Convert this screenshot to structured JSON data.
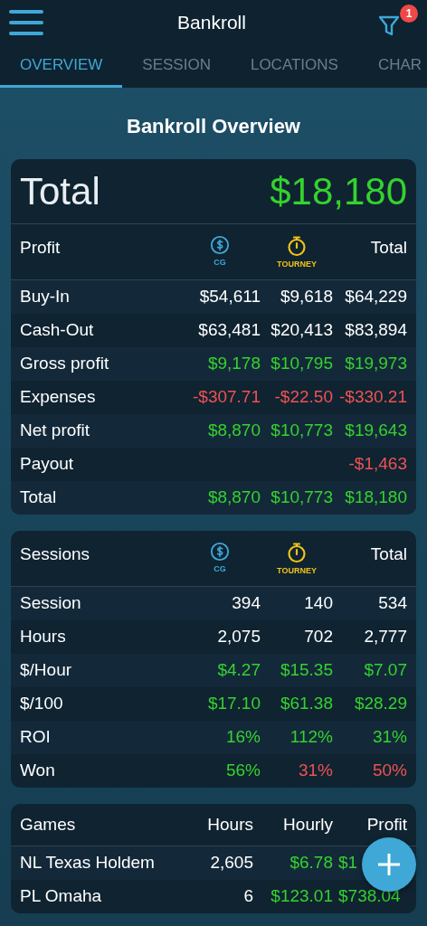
{
  "app_bar": {
    "title": "Bankroll",
    "filter_badge": "1"
  },
  "tabs": [
    {
      "label": "OVERVIEW",
      "selected": true
    },
    {
      "label": "SESSION",
      "selected": false
    },
    {
      "label": "LOCATIONS",
      "selected": false
    },
    {
      "label": "CHAR",
      "selected": false
    }
  ],
  "page_title": "Bankroll Overview",
  "total": {
    "label": "Total",
    "value": "$18,180",
    "color": "#35d22e"
  },
  "profit": {
    "columns": [
      {
        "kind": "text",
        "text": "Profit"
      },
      {
        "kind": "cash",
        "text": "CG"
      },
      {
        "kind": "tourney",
        "text": "TOURNEY"
      },
      {
        "kind": "text",
        "text": "Total"
      }
    ],
    "rows": [
      [
        {
          "text": "Buy-In",
          "color": "#ffffff"
        },
        {
          "text": "$54,611",
          "color": "#ffffff"
        },
        {
          "text": "$9,618",
          "color": "#ffffff"
        },
        {
          "text": "$64,229",
          "color": "#ffffff"
        }
      ],
      [
        {
          "text": "Cash-Out",
          "color": "#ffffff"
        },
        {
          "text": "$63,481",
          "color": "#ffffff"
        },
        {
          "text": "$20,413",
          "color": "#ffffff"
        },
        {
          "text": "$83,894",
          "color": "#ffffff"
        }
      ],
      [
        {
          "text": "Gross profit",
          "color": "#ffffff"
        },
        {
          "text": "$9,178",
          "color": "#35d22e"
        },
        {
          "text": "$10,795",
          "color": "#35d22e"
        },
        {
          "text": "$19,973",
          "color": "#35d22e"
        }
      ],
      [
        {
          "text": "Expenses",
          "color": "#ffffff"
        },
        {
          "text": "-$307.71",
          "color": "#f05252"
        },
        {
          "text": "-$22.50",
          "color": "#f05252"
        },
        {
          "text": "-$330.21",
          "color": "#f05252"
        }
      ],
      [
        {
          "text": "Net profit",
          "color": "#ffffff"
        },
        {
          "text": "$8,870",
          "color": "#35d22e"
        },
        {
          "text": "$10,773",
          "color": "#35d22e"
        },
        {
          "text": "$19,643",
          "color": "#35d22e"
        }
      ],
      [
        {
          "text": "Payout",
          "color": "#ffffff"
        },
        null,
        null,
        {
          "text": "-$1,463",
          "color": "#f05252"
        }
      ],
      [
        {
          "text": "Total",
          "color": "#ffffff"
        },
        {
          "text": "$8,870",
          "color": "#35d22e"
        },
        {
          "text": "$10,773",
          "color": "#35d22e"
        },
        {
          "text": "$18,180",
          "color": "#35d22e"
        }
      ]
    ]
  },
  "sessions": {
    "columns": [
      {
        "kind": "text",
        "text": "Sessions"
      },
      {
        "kind": "cash",
        "text": "CG"
      },
      {
        "kind": "tourney",
        "text": "TOURNEY"
      },
      {
        "kind": "text",
        "text": "Total"
      }
    ],
    "rows": [
      [
        {
          "text": "Session",
          "color": "#ffffff"
        },
        {
          "text": "394",
          "color": "#ffffff"
        },
        {
          "text": "140",
          "color": "#ffffff"
        },
        {
          "text": "534",
          "color": "#ffffff"
        }
      ],
      [
        {
          "text": "Hours",
          "color": "#ffffff"
        },
        {
          "text": "2,075",
          "color": "#ffffff"
        },
        {
          "text": "702",
          "color": "#ffffff"
        },
        {
          "text": "2,777",
          "color": "#ffffff"
        }
      ],
      [
        {
          "text": "$/Hour",
          "color": "#ffffff"
        },
        {
          "text": "$4.27",
          "color": "#35d22e"
        },
        {
          "text": "$15.35",
          "color": "#35d22e"
        },
        {
          "text": "$7.07",
          "color": "#35d22e"
        }
      ],
      [
        {
          "text": "$/100",
          "color": "#ffffff"
        },
        {
          "text": "$17.10",
          "color": "#35d22e"
        },
        {
          "text": "$61.38",
          "color": "#35d22e"
        },
        {
          "text": "$28.29",
          "color": "#35d22e"
        }
      ],
      [
        {
          "text": "ROI",
          "color": "#ffffff"
        },
        {
          "text": "16%",
          "color": "#35d22e"
        },
        {
          "text": "112%",
          "color": "#35d22e"
        },
        {
          "text": "31%",
          "color": "#35d22e"
        }
      ],
      [
        {
          "text": "Won",
          "color": "#ffffff"
        },
        {
          "text": "56%",
          "color": "#35d22e"
        },
        {
          "text": "31%",
          "color": "#f05252"
        },
        {
          "text": "50%",
          "color": "#f05252"
        }
      ]
    ]
  },
  "games": {
    "columns": [
      {
        "kind": "text",
        "text": "Games"
      },
      {
        "kind": "text",
        "text": "Hours"
      },
      {
        "kind": "text",
        "text": "Hourly"
      },
      {
        "kind": "text",
        "text": "Profit"
      }
    ],
    "rows": [
      [
        {
          "text": "NL Texas Holdem",
          "color": "#ffffff"
        },
        {
          "text": "2,605",
          "color": "#ffffff"
        },
        {
          "text": "$6.78",
          "color": "#35d22e"
        },
        {
          "text": "$1",
          "color": "#35d22e"
        }
      ],
      [
        {
          "text": "PL Omaha",
          "color": "#ffffff"
        },
        {
          "text": "6",
          "color": "#ffffff"
        },
        {
          "text": "$123.01",
          "color": "#35d22e"
        },
        {
          "text": "$738.04",
          "color": "#35d22e"
        }
      ]
    ]
  }
}
